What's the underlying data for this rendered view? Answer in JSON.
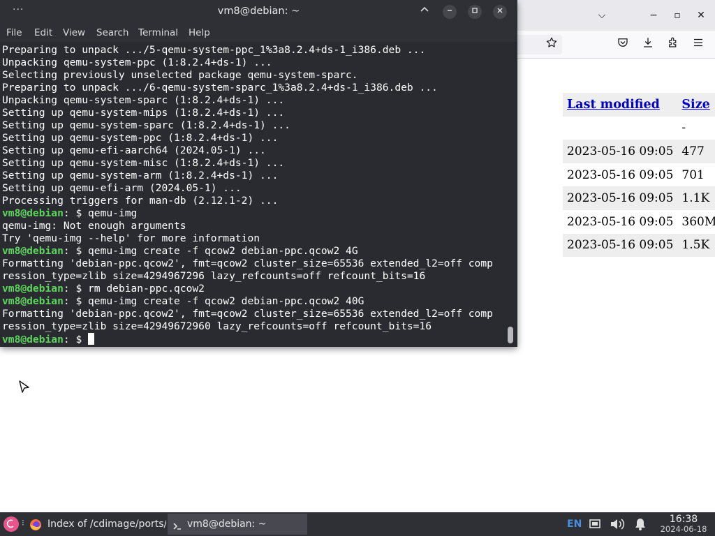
{
  "browser": {
    "window_buttons": {
      "list": "⌵",
      "minimize": "−",
      "maximize": "▫",
      "close": "✕"
    },
    "table": {
      "headers": {
        "last_modified": "Last modified",
        "size": "Size"
      },
      "rows": [
        {
          "date": "",
          "size": "-"
        },
        {
          "date": "2023-05-16 09:05",
          "size": "477"
        },
        {
          "date": "2023-05-16 09:05",
          "size": "701"
        },
        {
          "date": "2023-05-16 09:05",
          "size": "1.1K"
        },
        {
          "date": "2023-05-16 09:05",
          "size": "360M"
        },
        {
          "date": "2023-05-16 09:05",
          "size": "1.5K"
        }
      ]
    }
  },
  "terminal": {
    "title": "vm8@debian: ~",
    "dots": "···",
    "menu": [
      "File",
      "Edit",
      "View",
      "Search",
      "Terminal",
      "Help"
    ],
    "lines": [
      {
        "text": "Preparing to unpack .../5-qemu-system-ppc_1%3a8.2.4+ds-1_i386.deb ..."
      },
      {
        "text": "Unpacking qemu-system-ppc (1:8.2.4+ds-1) ..."
      },
      {
        "text": "Selecting previously unselected package qemu-system-sparc."
      },
      {
        "text": "Preparing to unpack .../6-qemu-system-sparc_1%3a8.2.4+ds-1_i386.deb ..."
      },
      {
        "text": "Unpacking qemu-system-sparc (1:8.2.4+ds-1) ..."
      },
      {
        "text": "Setting up qemu-system-mips (1:8.2.4+ds-1) ..."
      },
      {
        "text": "Setting up qemu-system-sparc (1:8.2.4+ds-1) ..."
      },
      {
        "text": "Setting up qemu-system-ppc (1:8.2.4+ds-1) ..."
      },
      {
        "text": "Setting up qemu-efi-aarch64 (2024.05-1) ..."
      },
      {
        "text": "Setting up qemu-system-misc (1:8.2.4+ds-1) ..."
      },
      {
        "text": "Setting up qemu-system-arm (1:8.2.4+ds-1) ..."
      },
      {
        "text": "Setting up qemu-efi-arm (2024.05-1) ..."
      },
      {
        "text": "Processing triggers for man-db (2.12.1-2) ..."
      },
      {
        "prompt": "vm8@debian",
        "rest": ": $ qemu-img"
      },
      {
        "text": "qemu-img: Not enough arguments"
      },
      {
        "text": "Try 'qemu-img --help' for more information"
      },
      {
        "prompt": "vm8@debian",
        "rest": ": $ qemu-img create -f qcow2 debian-ppc.qcow2 4G"
      },
      {
        "text": "Formatting 'debian-ppc.qcow2', fmt=qcow2 cluster_size=65536 extended_l2=off comp"
      },
      {
        "text": "ression_type=zlib size=4294967296 lazy_refcounts=off refcount_bits=16"
      },
      {
        "prompt": "vm8@debian",
        "rest": ": $ rm debian-ppc.qcow2"
      },
      {
        "prompt": "vm8@debian",
        "rest": ": $ qemu-img create -f qcow2 debian-ppc.qcow2 40G"
      },
      {
        "text": "Formatting 'debian-ppc.qcow2', fmt=qcow2 cluster_size=65536 extended_l2=off comp"
      },
      {
        "text": "ression_type=zlib size=42949672960 lazy_refcounts=off refcount_bits=16"
      },
      {
        "prompt": "vm8@debian",
        "rest": ": $ ",
        "cursor": true
      }
    ]
  },
  "taskbar": {
    "tasks": [
      {
        "label": "Index of /cdimage/ports/...",
        "icon": "firefox-icon"
      },
      {
        "label": "vm8@debian: ~",
        "icon": "terminal-icon"
      }
    ],
    "keyboard_layout": "EN",
    "clock": {
      "time": "16:38",
      "date": "2024-06-18"
    }
  },
  "colors": {
    "prompt_green": "#5cd55c",
    "terminal_bg": "#2a2b30",
    "link_blue": "#0000cc",
    "taskbar_bg": "#2f3035",
    "debian_red": "#e8558c"
  }
}
